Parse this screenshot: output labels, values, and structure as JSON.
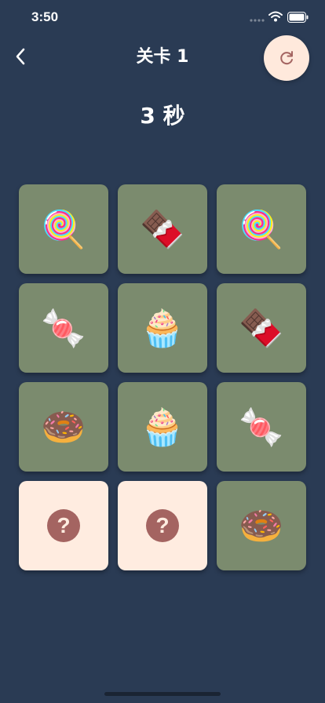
{
  "status_bar": {
    "time": "3:50"
  },
  "nav": {
    "title": "关卡 1"
  },
  "timer": {
    "text": "3 秒"
  },
  "colors": {
    "background": "#2a3b54",
    "card_revealed": "#7b8b6e",
    "card_hidden": "#ffece0",
    "question_badge": "#a46461",
    "reset_button": "#ffe9dc"
  },
  "cards": [
    {
      "state": "revealed",
      "emoji": "🍭",
      "icon": "lollipop-icon"
    },
    {
      "state": "revealed",
      "emoji": "🍫",
      "icon": "chocolate-bar-icon"
    },
    {
      "state": "revealed",
      "emoji": "🍭",
      "icon": "lollipop-icon"
    },
    {
      "state": "revealed",
      "emoji": "🍬",
      "icon": "candy-icon"
    },
    {
      "state": "revealed",
      "emoji": "🧁",
      "icon": "cupcake-icon"
    },
    {
      "state": "revealed",
      "emoji": "🍫",
      "icon": "chocolate-bar-icon"
    },
    {
      "state": "revealed",
      "emoji": "🍩",
      "icon": "donut-icon"
    },
    {
      "state": "revealed",
      "emoji": "🧁",
      "icon": "cupcake-icon"
    },
    {
      "state": "revealed",
      "emoji": "🍬",
      "icon": "candy-icon"
    },
    {
      "state": "hidden",
      "emoji": "?",
      "icon": "question-mark-icon"
    },
    {
      "state": "hidden",
      "emoji": "?",
      "icon": "question-mark-icon"
    },
    {
      "state": "revealed",
      "emoji": "🍩",
      "icon": "donut-icon"
    }
  ]
}
